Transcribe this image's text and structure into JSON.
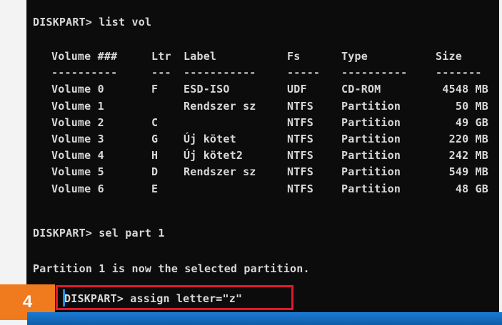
{
  "console": {
    "cmd_list": "DISKPART> list vol",
    "table": {
      "headers": [
        "Volume ###",
        "Ltr",
        "Label",
        "Fs",
        "Type",
        "Size"
      ],
      "separators": [
        "----------",
        "---",
        "-----------",
        "-----",
        "----------",
        "-------"
      ],
      "rows": [
        [
          "Volume 0",
          "F",
          "ESD-ISO",
          "UDF",
          "CD-ROM",
          "4548 MB"
        ],
        [
          "Volume 1",
          "",
          "Rendszer sz",
          "NTFS",
          "Partition",
          "50 MB"
        ],
        [
          "Volume 2",
          "C",
          "",
          "NTFS",
          "Partition",
          "49 GB"
        ],
        [
          "Volume 3",
          "G",
          "Új kötet",
          "NTFS",
          "Partition",
          "220 MB"
        ],
        [
          "Volume 4",
          "H",
          "Új kötet2",
          "NTFS",
          "Partition",
          "242 MB"
        ],
        [
          "Volume 5",
          "D",
          "Rendszer sz",
          "NTFS",
          "Partition",
          "549 MB"
        ],
        [
          "Volume 6",
          "E",
          "",
          "NTFS",
          "Partition",
          "48 GB"
        ]
      ]
    },
    "cmd_sel": "DISKPART> sel part 1",
    "msg_selected": "Partition 1 is now the selected partition.",
    "cmd_assign": "DISKPART> assign letter=\"z\""
  },
  "badge": {
    "number": "4",
    "color": "#f07a1e"
  },
  "highlight_color": "#e0182d",
  "cursor_color": "#1f8de8"
}
